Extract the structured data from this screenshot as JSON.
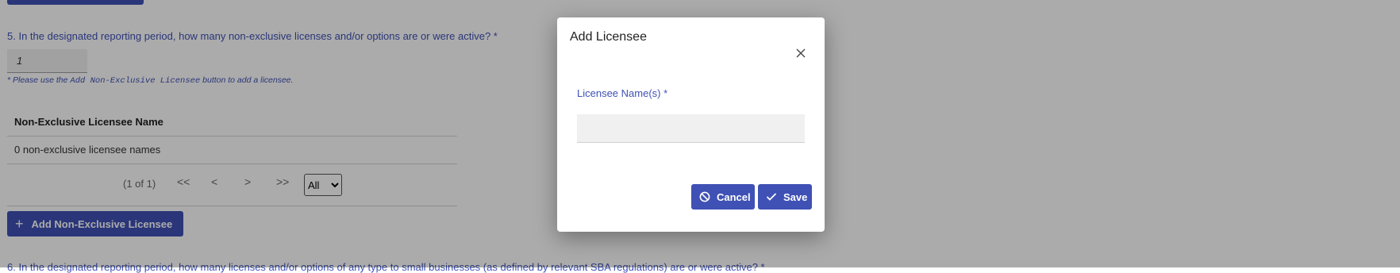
{
  "background_form": {
    "question_5": "5. In the designated reporting period, how many non-exclusive licenses and/or options are or were active? *",
    "answer_value": "1",
    "hint_prefix": "* Please use the ",
    "hint_code": "Add Non-Exclusive Licensee",
    "hint_suffix": " button to add a licensee.",
    "table": {
      "column_header": "Non-Exclusive Licensee Name",
      "empty_message": "0 non-exclusive licensee names"
    },
    "paginator": {
      "page_report": "(1 of 1)",
      "first": "<<",
      "prev": "<",
      "next": ">",
      "last": ">>",
      "rows_option": "All"
    },
    "add_button_label": "Add Non-Exclusive Licensee",
    "question_6": "6. In the designated reporting period, how many licenses and/or options of any type to small businesses (as defined by relevant SBA regulations) are or were active? *"
  },
  "dialog": {
    "title": "Add Licensee",
    "field_label": "Licensee Name(s) *",
    "field_value": "",
    "cancel_label": "Cancel",
    "save_label": "Save"
  },
  "icons": {
    "close": "close-icon",
    "cancel": "ban-icon",
    "save": "check-icon",
    "add": "plus-icon"
  },
  "colors": {
    "primary": "#3f51b5",
    "overlay": "rgba(0,0,0,0.33)"
  }
}
